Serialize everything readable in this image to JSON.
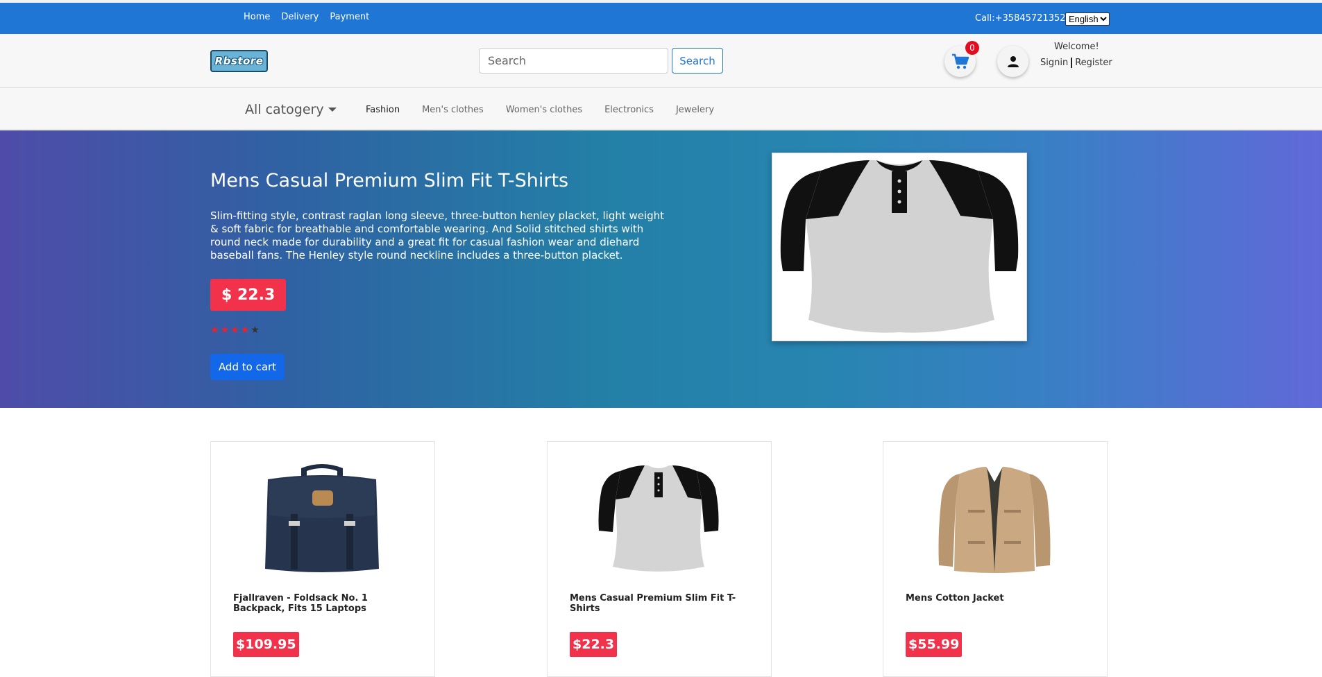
{
  "topbar": {
    "nav": [
      "Home",
      "Delivery",
      "Payment"
    ],
    "call": "Call:+35845721352",
    "language": "English"
  },
  "header": {
    "logo": "Rbstore",
    "search_placeholder": "Search",
    "search_button": "Search",
    "cart_count": "0",
    "welcome": "Welcome!",
    "signin": "Signin",
    "register": "Register"
  },
  "categories": {
    "all": "All catogery",
    "items": [
      "Fashion",
      "Men's clothes",
      "Women's clothes",
      "Electronics",
      "Jewelery"
    ]
  },
  "hero": {
    "title": "Mens Casual Premium Slim Fit T-Shirts",
    "description": "Slim-fitting style, contrast raglan long sleeve, three-button henley placket, light weight & soft fabric for breathable and comfortable wearing. And Solid stitched shirts with round neck made for durability and a great fit for casual fashion wear and diehard baseball fans. The Henley style round neckline includes a three-button placket.",
    "price": "$ 22.3",
    "rating": 4,
    "rating_max": 5,
    "add_to_cart": "Add to cart"
  },
  "products": [
    {
      "title": "Fjallraven - Foldsack No. 1 Backpack, Fits 15 Laptops",
      "price": "$109.95"
    },
    {
      "title": "Mens Casual Premium Slim Fit T-Shirts",
      "price": "$22.3"
    },
    {
      "title": "Mens Cotton Jacket",
      "price": "$55.99"
    }
  ],
  "colors": {
    "topbar": "#1f76d4",
    "price_badge": "#f2324a",
    "button": "#1268e8"
  }
}
